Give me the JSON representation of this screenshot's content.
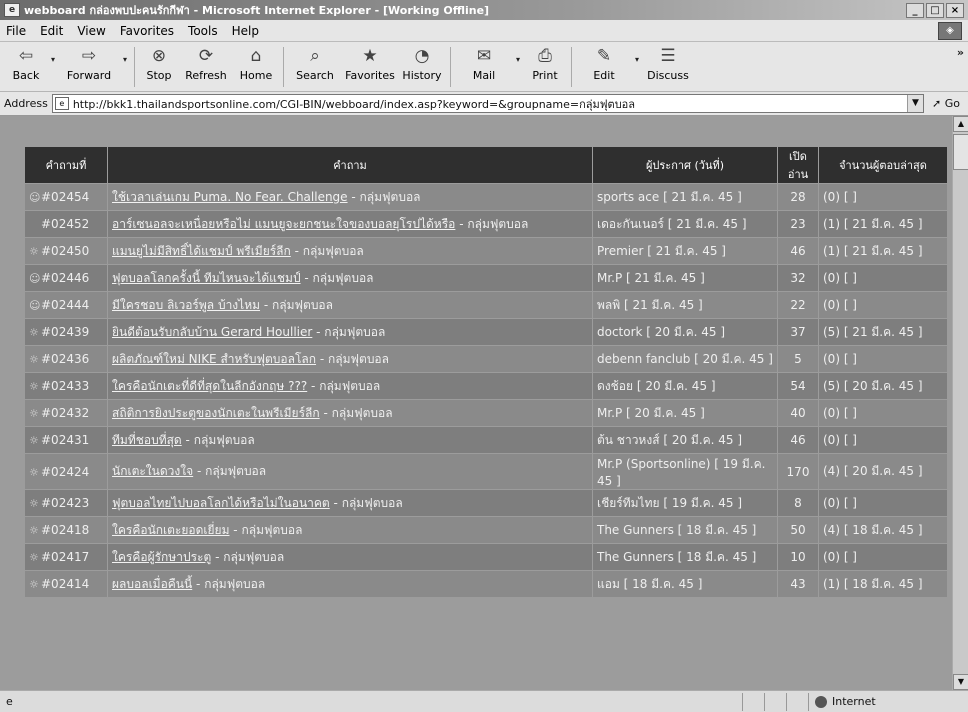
{
  "window": {
    "title": "webboard กล่องพบปะคนรักกีฬา - Microsoft Internet Explorer - [Working Offline]",
    "controls": {
      "minimize": "_",
      "maximize": "□",
      "close": "×"
    }
  },
  "menu": {
    "items": [
      "File",
      "Edit",
      "View",
      "Favorites",
      "Tools",
      "Help"
    ]
  },
  "toolbar": {
    "buttons": [
      {
        "label": "Back",
        "icon": "back-arrow-icon",
        "glyph": "⇦",
        "dropdown": true
      },
      {
        "label": "Forward",
        "icon": "forward-arrow-icon",
        "glyph": "⇨",
        "dropdown": true
      },
      {
        "label": "Stop",
        "icon": "stop-icon",
        "glyph": "⊗",
        "dropdown": false
      },
      {
        "label": "Refresh",
        "icon": "refresh-icon",
        "glyph": "⟳",
        "dropdown": false
      },
      {
        "label": "Home",
        "icon": "home-icon",
        "glyph": "⌂",
        "dropdown": false
      },
      {
        "label": "Search",
        "icon": "search-icon",
        "glyph": "⌕",
        "dropdown": false
      },
      {
        "label": "Favorites",
        "icon": "favorites-icon",
        "glyph": "★",
        "dropdown": false
      },
      {
        "label": "History",
        "icon": "history-icon",
        "glyph": "◔",
        "dropdown": false
      },
      {
        "label": "Mail",
        "icon": "mail-icon",
        "glyph": "✉",
        "dropdown": true
      },
      {
        "label": "Print",
        "icon": "print-icon",
        "glyph": "⎙",
        "dropdown": false
      },
      {
        "label": "Edit",
        "icon": "edit-icon",
        "glyph": "✎",
        "dropdown": true
      },
      {
        "label": "Discuss",
        "icon": "discuss-icon",
        "glyph": "☰",
        "dropdown": false
      }
    ],
    "more": "»"
  },
  "address": {
    "label": "Address",
    "url": "http://bkk1.thailandsportsonline.com/CGI-BIN/webboard/index.asp?keyword=&groupname=กลุ่มฟุตบอล",
    "go": "Go"
  },
  "board": {
    "headers": [
      "คำถามที่",
      "คำถาม",
      "ผู้ประกาศ (วันที่)",
      "เปิดอ่าน",
      "จำนวนผู้ตอบล่าสุด"
    ],
    "rows": [
      {
        "icon": "☺",
        "number": "#02454",
        "subject": "ใช้เวลาเล่นเกม Puma. No Fear. Challenge",
        "group": "กลุ่มฟุตบอล",
        "poster": "sports ace [ 21 มี.ค. 45 ]",
        "reads": "28",
        "last": "(0) [ ]"
      },
      {
        "icon": "",
        "number": "#02452",
        "subject": "อาร์เซนอลจะเหนื่อยหรือไม่ แมนยูจะยกชนะใจของบอลยุโรปได้หรือ",
        "group": "กลุ่มฟุตบอล",
        "poster": "เดอะกันเนอร์ [ 21 มี.ค. 45 ]",
        "reads": "23",
        "last": "(1) [ 21 มี.ค. 45 ]"
      },
      {
        "icon": "☼",
        "number": "#02450",
        "subject": "แมนยูไม่มีสิทธิ์ได้แชมป์ พรีเมียร์ลีก",
        "group": "กลุ่มฟุตบอล",
        "poster": "Premier [ 21 มี.ค. 45 ]",
        "reads": "46",
        "last": "(1) [ 21 มี.ค. 45 ]"
      },
      {
        "icon": "☺",
        "number": "#02446",
        "subject": "ฟุตบอลโลกครั้งนี้ ทีมไหนจะได้แชมป์",
        "group": "กลุ่มฟุตบอล",
        "poster": "Mr.P [ 21 มี.ค. 45 ]",
        "reads": "32",
        "last": "(0) [ ]"
      },
      {
        "icon": "☺",
        "number": "#02444",
        "subject": "มีใครชอบ ลิเวอร์พูล บ้างไหม",
        "group": "กลุ่มฟุตบอล",
        "poster": "พลพิ [ 21 มี.ค. 45 ]",
        "reads": "22",
        "last": "(0) [ ]"
      },
      {
        "icon": "☼",
        "number": "#02439",
        "subject": "ยินดีต้อนรับกลับบ้าน Gerard Houllier",
        "group": "กลุ่มฟุตบอล",
        "poster": "doctork [ 20 มี.ค. 45 ]",
        "reads": "37",
        "last": "(5) [ 21 มี.ค. 45 ]"
      },
      {
        "icon": "☼",
        "number": "#02436",
        "subject": "ผลิตภัณฑ์ใหม่ NIKE สำหรับฟุตบอลโลก",
        "group": "กลุ่มฟุตบอล",
        "poster": "debenn fanclub [ 20 มี.ค. 45 ]",
        "reads": "5",
        "last": "(0) [ ]"
      },
      {
        "icon": "☼",
        "number": "#02433",
        "subject": "ใครคือนักเตะที่ดีที่สุดในลีกอังกฤษ ???",
        "group": "กลุ่มฟุตบอล",
        "poster": "ดงช้อย [ 20 มี.ค. 45 ]",
        "reads": "54",
        "last": "(5) [ 20 มี.ค. 45 ]"
      },
      {
        "icon": "☼",
        "number": "#02432",
        "subject": "สถิติการยิงประตูของนักเตะในพรีเมียร์ลีก",
        "group": "กลุ่มฟุตบอล",
        "poster": "Mr.P [ 20 มี.ค. 45 ]",
        "reads": "40",
        "last": "(0) [ ]"
      },
      {
        "icon": "☼",
        "number": "#02431",
        "subject": "ทีมที่ชอบที่สุด",
        "group": "กลุ่มฟุตบอล",
        "poster": "ต้น ชาวหงส์ [ 20 มี.ค. 45 ]",
        "reads": "46",
        "last": "(0) [ ]"
      },
      {
        "icon": "☼",
        "number": "#02424",
        "subject": "นักเตะในดวงใจ",
        "group": "กลุ่มฟุตบอล",
        "poster": "Mr.P (Sportsonline) [ 19 มี.ค. 45 ]",
        "reads": "170",
        "last": "(4) [ 20 มี.ค. 45 ]"
      },
      {
        "icon": "☼",
        "number": "#02423",
        "subject": "ฟุตบอลไทยไปบอลโลกได้หรือไม่ในอนาคต",
        "group": "กลุ่มฟุตบอล",
        "poster": "เชียร์ทีมไทย [ 19 มี.ค. 45 ]",
        "reads": "8",
        "last": "(0) [ ]"
      },
      {
        "icon": "☼",
        "number": "#02418",
        "subject": "ใครคือนักเตะยอดเยี่ยม",
        "group": "กลุ่มฟุตบอล",
        "poster": "The Gunners [ 18 มี.ค. 45 ]",
        "reads": "50",
        "last": "(4) [ 18 มี.ค. 45 ]"
      },
      {
        "icon": "☼",
        "number": "#02417",
        "subject": "ใครคือผู้รักษาประตู",
        "group": "กลุ่มฟุตบอล",
        "poster": "The Gunners [ 18 มี.ค. 45 ]",
        "reads": "10",
        "last": "(0) [ ]"
      },
      {
        "icon": "☼",
        "number": "#02414",
        "subject": "ผลบอลเมื่อคืนนี้",
        "group": "กลุ่มฟุตบอล",
        "poster": "แอม [ 18 มี.ค. 45 ]",
        "reads": "43",
        "last": "(1) [ 18 มี.ค. 45 ]"
      }
    ]
  },
  "status": {
    "text": "",
    "zone": "Internet"
  }
}
